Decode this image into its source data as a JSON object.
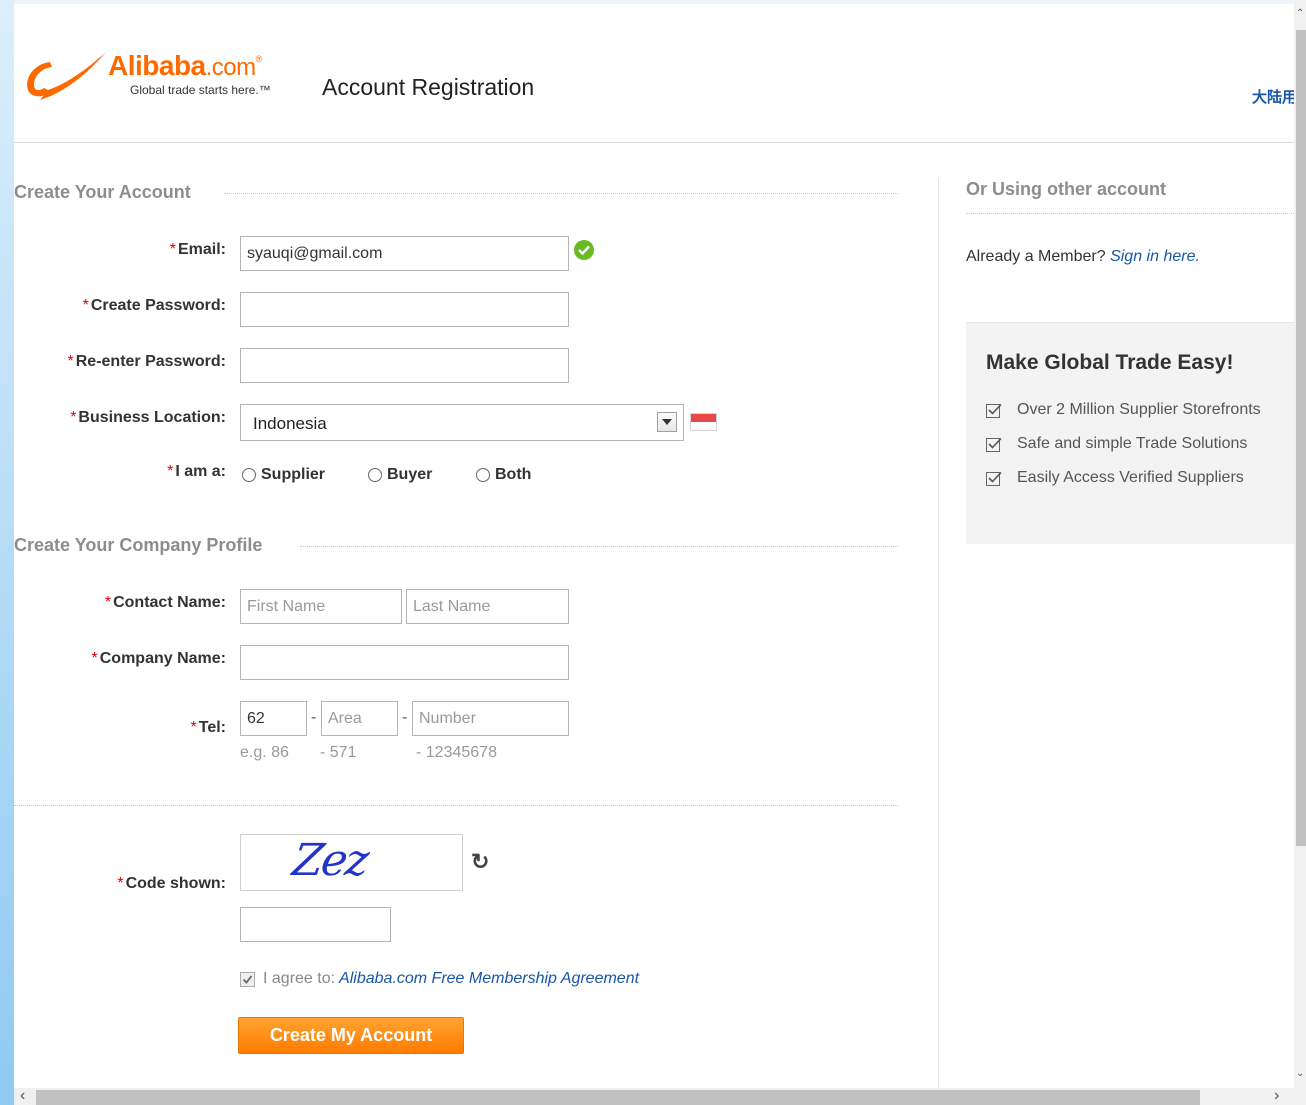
{
  "header": {
    "logo_brand": "Alibaba",
    "logo_suffix": ".com",
    "logo_mark": "®",
    "logo_tagline": "Global trade starts here.™",
    "page_title": "Account Registration",
    "language_link": "大陆用户"
  },
  "account_section": {
    "title": "Create Your Account",
    "email": {
      "label": "Email:",
      "value": "syauqi@gmail.com",
      "valid": true
    },
    "password": {
      "label": "Create Password:",
      "value": ""
    },
    "password_confirm": {
      "label": "Re-enter Password:",
      "value": ""
    },
    "location": {
      "label": "Business Location:",
      "value": "Indonesia",
      "flag": "indonesia-flag"
    },
    "role": {
      "label": "I am a:",
      "options": [
        "Supplier",
        "Buyer",
        "Both"
      ],
      "selected": null
    }
  },
  "company_section": {
    "title": "Create Your Company Profile",
    "contact": {
      "label": "Contact Name:",
      "first_placeholder": "First Name",
      "last_placeholder": "Last Name"
    },
    "company": {
      "label": "Company Name:",
      "value": ""
    },
    "tel": {
      "label": "Tel:",
      "country_value": "62",
      "area_placeholder": "Area",
      "number_placeholder": "Number",
      "separator": "-",
      "hint_country": "e.g.  86",
      "hint_area": "-  571",
      "hint_number": "-  12345678"
    }
  },
  "verification": {
    "label": "Code shown:",
    "captcha_text": "Zez",
    "refresh_icon": "refresh-icon",
    "code_value": ""
  },
  "agreement": {
    "prefix": "I agree to:",
    "link": "Alibaba.com Free Membership Agreement",
    "checked": true
  },
  "submit_label": "Create My Account",
  "sidebar": {
    "other_title": "Or Using other account",
    "member_prefix": "Already a Member?",
    "member_link": "Sign in here.",
    "promo_title": "Make Global Trade Easy!",
    "promo_items": [
      "Over 2 Million Supplier Storefronts",
      "Safe and simple Trade Solutions",
      "Easily Access Verified Suppliers"
    ]
  },
  "colors": {
    "brand_orange": "#ff6a00",
    "link_blue": "#1a56a7",
    "required_red": "#e40000",
    "valid_green": "#6aba21"
  }
}
